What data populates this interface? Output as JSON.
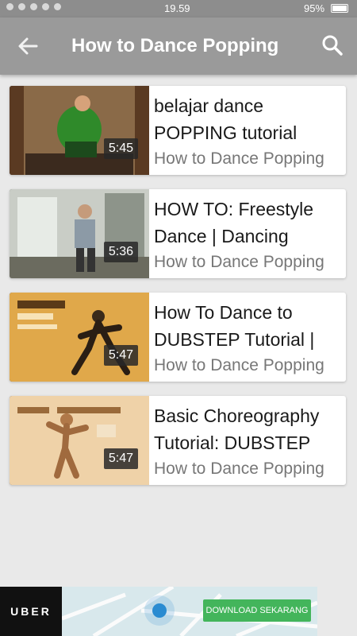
{
  "status_bar": {
    "time": "19.59",
    "battery": "95%"
  },
  "toolbar": {
    "title": "How to Dance Popping",
    "back_icon": "arrow-back-icon",
    "search_icon": "search-icon"
  },
  "videos": [
    {
      "title_line1": "belajar dance",
      "title_line2": "POPPING tutorial",
      "channel": "How to Dance Popping",
      "duration": "5:45"
    },
    {
      "title_line1": "HOW TO: Freestyle",
      "title_line2": "Dance | Dancing",
      "channel": "How to Dance Popping",
      "duration": "5:36"
    },
    {
      "title_line1": "How To Dance to",
      "title_line2": "DUBSTEP Tutorial |",
      "channel": "How to Dance Popping",
      "duration": "5:47"
    },
    {
      "title_line1": "Basic Choreography",
      "title_line2": "Tutorial: DUBSTEP",
      "channel": "How to Dance Popping",
      "duration": "5:47"
    }
  ],
  "ad": {
    "brand": "UBER",
    "cta": "DOWNLOAD SEKARANG"
  },
  "colors": {
    "toolbar": "#9a9a9a",
    "background": "#e9e9e9",
    "cta": "#43b55b"
  }
}
